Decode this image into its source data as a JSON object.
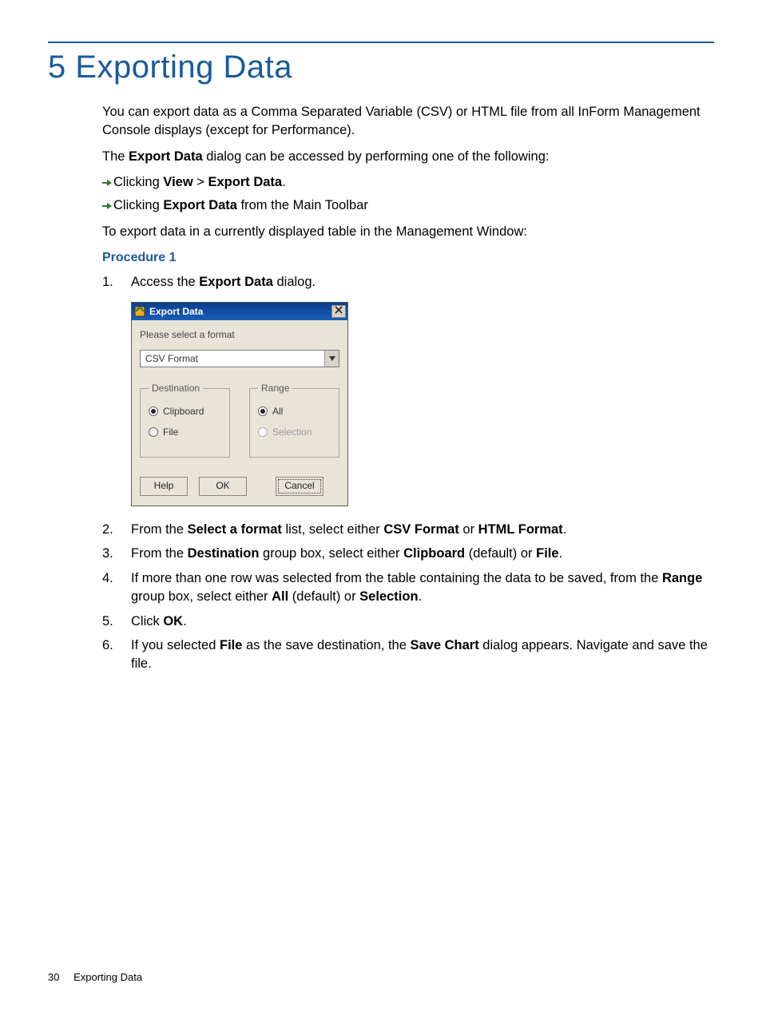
{
  "chapter": {
    "title": "5 Exporting Data"
  },
  "paragraphs": {
    "intro": "You can export data as a Comma Separated Variable (CSV) or HTML file from all InForm Management Console displays (except for Performance).",
    "access_lead": "The ",
    "access_bold1": "Export Data",
    "access_trail": " dialog can be accessed by performing one of the following:",
    "bullet1_lead": "Clicking ",
    "bullet1_b1": "View",
    "bullet1_sep": " > ",
    "bullet1_b2": "Export Data",
    "bullet1_trail": ".",
    "bullet2_lead": "Clicking ",
    "bullet2_b1": "Export Data",
    "bullet2_trail": " from the Main Toolbar",
    "export_lead": "To export data in a currently displayed table in the Management Window:",
    "procedure_label": "Procedure 1"
  },
  "steps": {
    "s1_num": "1.",
    "s1_lead": "Access the ",
    "s1_b1": "Export Data",
    "s1_trail": " dialog.",
    "s2_num": "2.",
    "s2_lead": "From the ",
    "s2_b1": "Select a format",
    "s2_mid1": " list, select either ",
    "s2_b2": "CSV Format",
    "s2_mid2": " or ",
    "s2_b3": "HTML Format",
    "s2_trail": ".",
    "s3_num": "3.",
    "s3_lead": "From the ",
    "s3_b1": "Destination",
    "s3_mid1": " group box, select either ",
    "s3_b2": "Clipboard",
    "s3_mid2": " (default) or ",
    "s3_b3": "File",
    "s3_trail": ".",
    "s4_num": "4.",
    "s4_lead": "If more than one row was selected from the table containing the data to be saved, from the ",
    "s4_b1": "Range",
    "s4_mid1": " group box, select either ",
    "s4_b2": "All",
    "s4_mid2": " (default) or ",
    "s4_b3": "Selection",
    "s4_trail": ".",
    "s5_num": "5.",
    "s5_lead": "Click ",
    "s5_b1": "OK",
    "s5_trail": ".",
    "s6_num": "6.",
    "s6_lead": "If you selected ",
    "s6_b1": "File",
    "s6_mid1": " as the save destination, the ",
    "s6_b2": "Save Chart",
    "s6_trail": " dialog appears. Navigate and save the file."
  },
  "dialog": {
    "title": "Export Data",
    "prompt": "Please select a format",
    "format_value": "CSV Format",
    "destination": {
      "legend": "Destination",
      "opt_clipboard": "Clipboard",
      "opt_file": "File"
    },
    "range": {
      "legend": "Range",
      "opt_all": "All",
      "opt_selection": "Selection"
    },
    "buttons": {
      "help": "Help",
      "ok": "OK",
      "cancel": "Cancel"
    }
  },
  "footer": {
    "page_number": "30",
    "section": "Exporting Data"
  }
}
